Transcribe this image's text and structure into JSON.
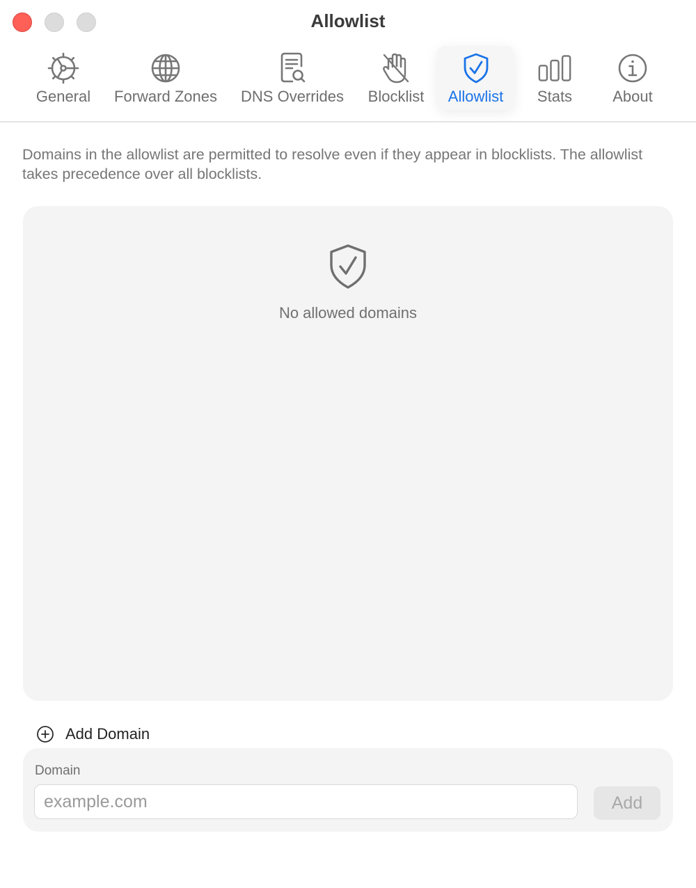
{
  "window": {
    "title": "Allowlist"
  },
  "tabs": [
    {
      "label": "General",
      "icon": "gear-icon"
    },
    {
      "label": "Forward Zones",
      "icon": "globe-icon"
    },
    {
      "label": "DNS Overrides",
      "icon": "document-search-icon"
    },
    {
      "label": "Blocklist",
      "icon": "hand-raised-icon"
    },
    {
      "label": "Allowlist",
      "icon": "shield-check-icon",
      "active": true
    },
    {
      "label": "Stats",
      "icon": "bar-chart-icon"
    },
    {
      "label": "About",
      "icon": "info-icon"
    }
  ],
  "description": "Domains in the allowlist are permitted to resolve even if they appear in blocklists. The allowlist takes precedence over all blocklists.",
  "list": {
    "empty_text": "No allowed domains",
    "empty_icon": "shield-check-icon"
  },
  "add_section": {
    "title": "Add Domain",
    "field_label": "Domain",
    "placeholder": "example.com",
    "value": "",
    "button_label": "Add"
  },
  "colors": {
    "accent": "#1a73e8",
    "close_button": "#fe5f57",
    "panel_background": "#f4f4f4"
  }
}
